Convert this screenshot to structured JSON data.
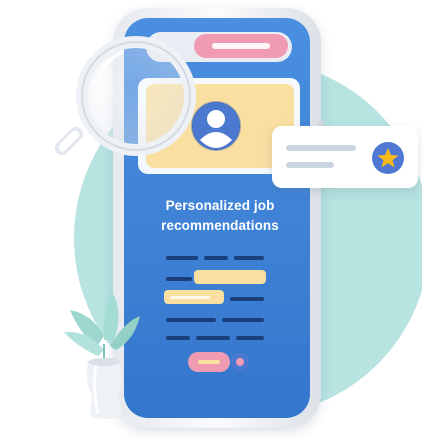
{
  "screen": {
    "headline_line1": "Personalized job",
    "headline_line2": "recommendations"
  },
  "colors": {
    "background_circle": "#b7e3e1",
    "phone_screen": "#3b82d6",
    "phone_frame": "#f1f3f6",
    "profile_card": "#f9dfa0",
    "avatar": "#4a79cf",
    "top_pill": "#f19bb3",
    "highlight_bars": "#f9dfa0",
    "star_badge": "#5078d4",
    "star": "#f6b81c",
    "plant": "#a3dcd4",
    "vase": "#e7ecf1"
  },
  "icons": [
    "magnifier-icon",
    "avatar-icon",
    "star-badge-icon",
    "plant-icon"
  ]
}
